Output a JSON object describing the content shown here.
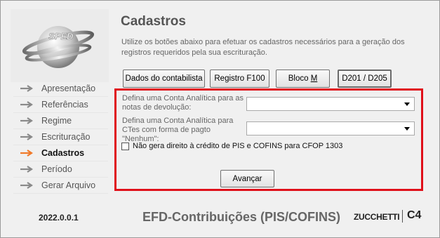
{
  "header": {
    "title": "Cadastros",
    "description": "Utilize os botões abaixo para efetuar os cadastros necessários para a geração dos registros requeridos pela sua escrituração."
  },
  "logo": {
    "text": "SPED"
  },
  "nav": {
    "items": [
      {
        "label": "Apresentação",
        "active": false
      },
      {
        "label": "Referências",
        "active": false
      },
      {
        "label": "Regime",
        "active": false
      },
      {
        "label": "Escrituração",
        "active": false
      },
      {
        "label": "Cadastros",
        "active": true
      },
      {
        "label": "Período",
        "active": false
      },
      {
        "label": "Gerar Arquivo",
        "active": false
      }
    ]
  },
  "buttons": {
    "dados_contabilista": "Dados do contabilista",
    "registro_f100": "Registro F100",
    "bloco_m_prefix": "Bloco ",
    "bloco_m_underlined": "M",
    "d201_d205": "D201 / D205"
  },
  "form": {
    "field1_label": "Defina uma Conta Analítica para as notas de devolução:",
    "field1_value": "",
    "field2_label": "Defina uma Conta Analítica para CTes com forma de pagto \"Nenhum\":",
    "field2_value": "",
    "checkbox_label": "Não gera direito à crédito de PIS e COFINS para CFOP 1303",
    "checkbox_checked": false,
    "advance_label": "Avançar"
  },
  "footer": {
    "version": "2022.0.0.1",
    "product": "EFD-Contribuições (PIS/COFINS)",
    "brand": "ZUCCHETTI",
    "brand_mark": "C4"
  },
  "colors": {
    "highlight_border": "#e0101a",
    "active_arrow": "#f07a2a",
    "inactive_arrow": "#8a8a8a"
  }
}
